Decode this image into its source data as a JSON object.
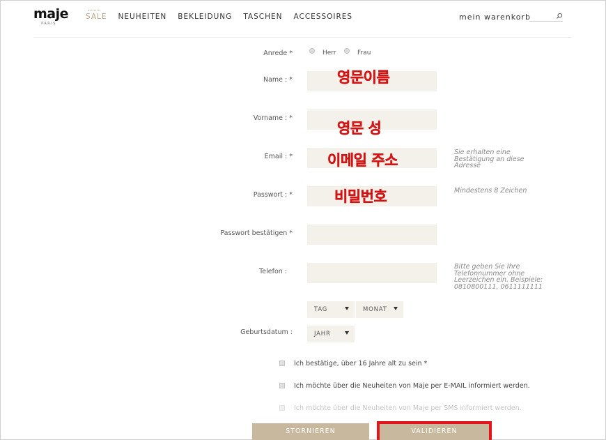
{
  "header": {
    "logo": "maje",
    "logo_sub": "PARIS",
    "nav": [
      "SALE",
      "NEUHEITEN",
      "BEKLEIDUNG",
      "TASCHEN",
      "ACCESSOIRES"
    ],
    "cart": "mein warenkorb",
    "search_placeholder": ""
  },
  "form": {
    "salutation": {
      "label": "Anrede *",
      "options": [
        "Herr",
        "Frau"
      ]
    },
    "name": {
      "label": "Name : *",
      "value": "",
      "overlay": "영문이름"
    },
    "vorname": {
      "label": "Vorname : *",
      "value": "",
      "overlay": "영문 성"
    },
    "email": {
      "label": "Email : *",
      "value": "",
      "overlay": "이메일 주소",
      "hint": "Sie erhalten eine Bestätigung an diese Adresse"
    },
    "password": {
      "label": "Passwort : *",
      "value": "",
      "overlay": "비밀번호",
      "hint": "Mindestens 8 Zeichen"
    },
    "password_confirm": {
      "label": "Passwort bestätigen *",
      "value": ""
    },
    "telefon": {
      "label": "Telefon :",
      "value": "",
      "hint": "Bitte geben Sie Ihre Telefonnummer ohne Leerzeichen ein. Beispiele: 0810800111, 0611111111"
    },
    "birthdate": {
      "label": "Geburtsdatum :",
      "day": "TAG",
      "month": "MONAT",
      "year": "JAHR"
    },
    "checks": [
      {
        "label": "Ich bestätige, über 16 Jahre alt zu sein *"
      },
      {
        "label": "Ich möchte über die Neuheiten von Maje per E-MAIL informiert werden."
      },
      {
        "label": "Ich möchte über die Neuheiten von Maje per SMS informiert werden."
      }
    ],
    "cancel_label": "STORNIEREN",
    "submit_label": "VALIDIEREN"
  },
  "colors": {
    "accent": "#c8b99e",
    "field_bg": "#f4f0ea",
    "annotation_red": "#d21414"
  }
}
